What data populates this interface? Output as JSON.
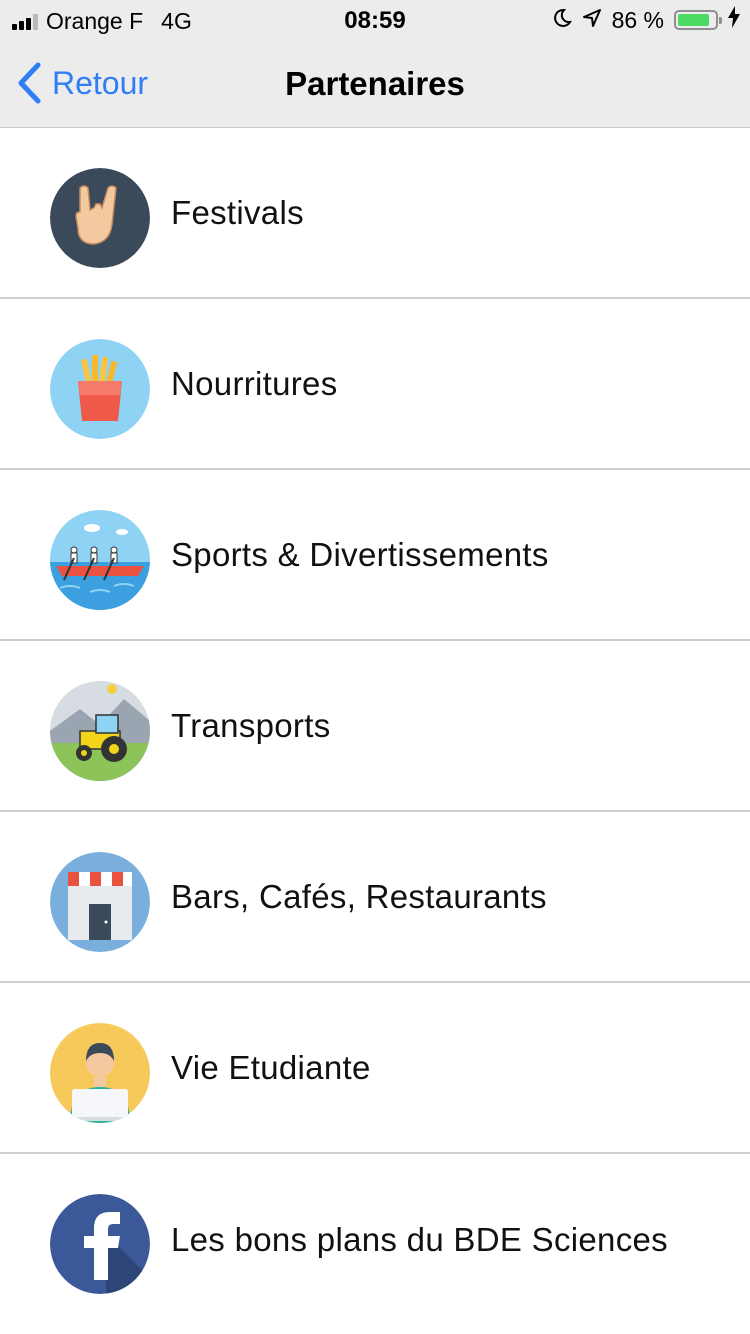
{
  "status_bar": {
    "carrier": "Orange F",
    "network": "4G",
    "time": "08:59",
    "battery_percent": "86 %",
    "battery_level": 0.86,
    "icons": [
      "signal-icon",
      "moon-icon",
      "location-arrow-icon",
      "battery-icon",
      "charging-bolt-icon"
    ]
  },
  "nav": {
    "back_label": "Retour",
    "title": "Partenaires"
  },
  "colors": {
    "accent": "#2f7ef6",
    "bar_background": "#ececec",
    "separator": "#cfcfd2",
    "battery_fill": "#4cd964"
  },
  "categories": [
    {
      "label": "Festivals",
      "icon": "rock-hand-icon"
    },
    {
      "label": "Nourritures",
      "icon": "fries-icon"
    },
    {
      "label": "Sports & Divertissements",
      "icon": "rowing-icon"
    },
    {
      "label": "Transports",
      "icon": "tractor-icon"
    },
    {
      "label": "Bars, Cafés, Restaurants",
      "icon": "storefront-icon"
    },
    {
      "label": "Vie Etudiante",
      "icon": "student-icon"
    },
    {
      "label": "Les bons plans du BDE Sciences",
      "icon": "facebook-icon"
    }
  ]
}
